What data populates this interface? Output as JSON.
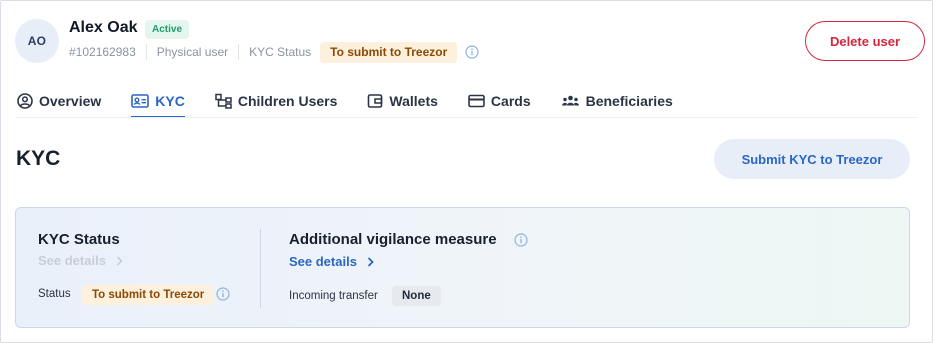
{
  "user": {
    "initials": "AO",
    "name": "Alex Oak",
    "status_badge": "Active",
    "id": "#102162983",
    "type": "Physical user",
    "kyc_status_label": "KYC Status",
    "kyc_status_value": "To submit to Treezor"
  },
  "header": {
    "delete_label": "Delete user"
  },
  "tabs": [
    {
      "label": "Overview",
      "icon": "user-circle-icon",
      "active": false
    },
    {
      "label": "KYC",
      "icon": "id-card-icon",
      "active": true
    },
    {
      "label": "Children Users",
      "icon": "hierarchy-icon",
      "active": false
    },
    {
      "label": "Wallets",
      "icon": "wallet-icon",
      "active": false
    },
    {
      "label": "Cards",
      "icon": "credit-card-icon",
      "active": false
    },
    {
      "label": "Beneficiaries",
      "icon": "people-group-icon",
      "active": false
    }
  ],
  "section": {
    "title": "KYC",
    "submit_label": "Submit KYC to Treezor"
  },
  "kyc_card": {
    "status_title": "KYC Status",
    "status_see_details": "See details",
    "status_row_label": "Status",
    "status_row_value": "To submit to Treezor",
    "vigilance_title": "Additional vigilance measure",
    "vigilance_see_details": "See details",
    "incoming_label": "Incoming transfer",
    "incoming_value": "None"
  },
  "colors": {
    "accent": "#2a67c5",
    "danger": "#d7263d",
    "warning_bg": "#fdf0dc",
    "warning_text": "#8a4a06",
    "success_bg": "#e5f6ef",
    "success_text": "#1f9d6b"
  }
}
